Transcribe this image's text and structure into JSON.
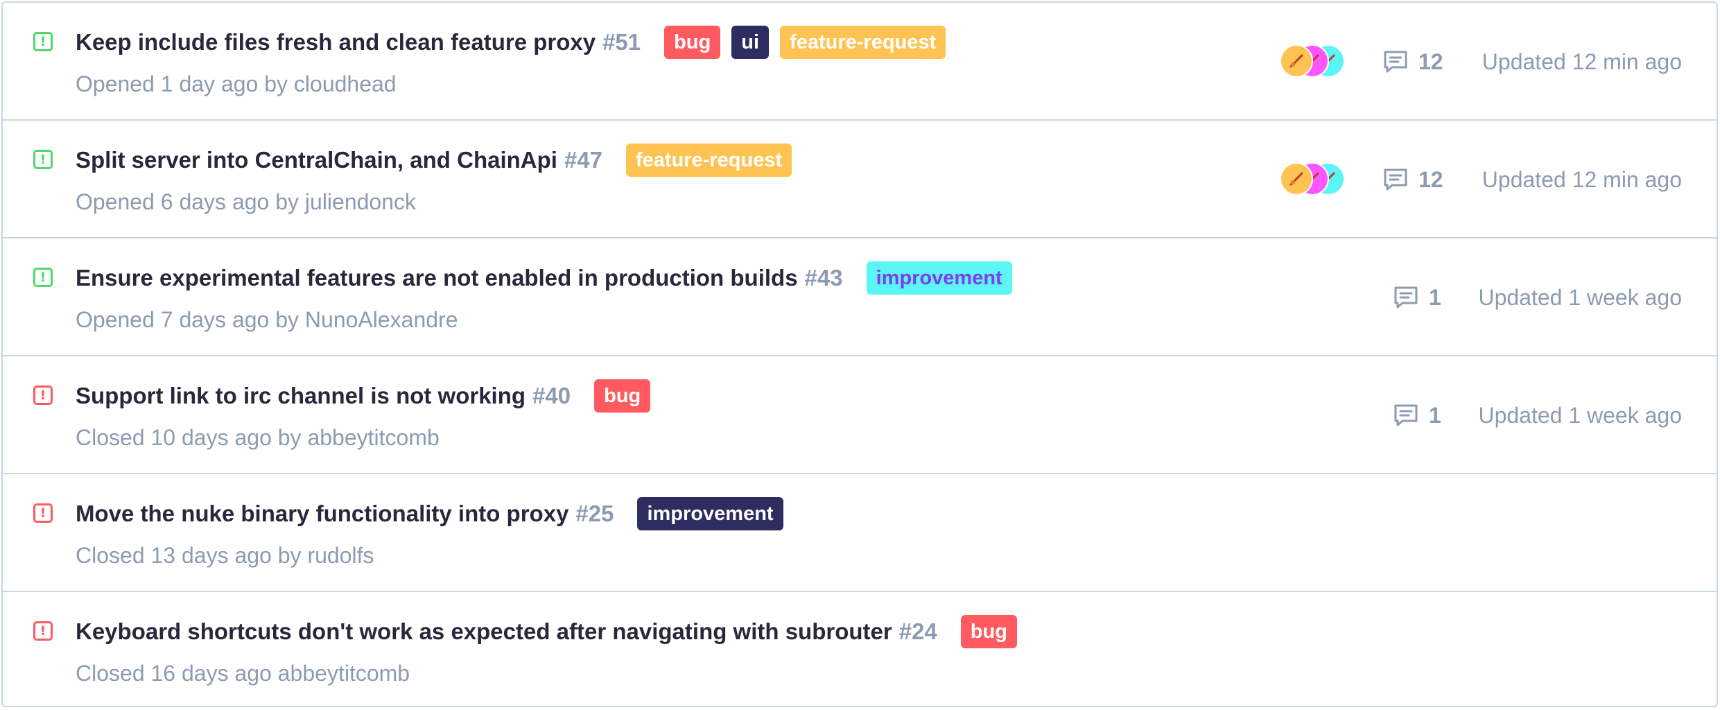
{
  "colors": {
    "open": "#4cd964",
    "closed": "#ff5a5f",
    "border": "#c9d6e3",
    "muted": "#8c9bb1",
    "text": "#28283c",
    "label_bug": "#ff5a5f",
    "label_ui": "#2d2d5f",
    "label_feature_request": "#ffc353",
    "label_improvement_cyan": "#5cf5f5",
    "label_improvement_navy": "#2d2d5f"
  },
  "issues": [
    {
      "status": "open",
      "title": "Keep include files fresh and clean feature proxy",
      "number": "#51",
      "labels": [
        {
          "text": "bug",
          "bg": "#ff5a5f",
          "fg": "#ffffff"
        },
        {
          "text": "ui",
          "bg": "#2d2d5f",
          "fg": "#ffffff"
        },
        {
          "text": "feature-request",
          "bg": "#ffc353",
          "fg": "#ffffff"
        }
      ],
      "meta": "Opened 1 day ago by cloudhead",
      "avatars": [
        "#ffc353",
        "#ff55ff",
        "#5cf5f5"
      ],
      "comments": "12",
      "updated": "Updated 12 min ago"
    },
    {
      "status": "open",
      "title": "Split server into CentralChain, and ChainApi",
      "number": "#47",
      "labels": [
        {
          "text": "feature-request",
          "bg": "#ffc353",
          "fg": "#ffffff"
        }
      ],
      "meta": "Opened 6 days ago by juliendonck",
      "avatars": [
        "#ffc353",
        "#ff55ff",
        "#5cf5f5"
      ],
      "comments": "12",
      "updated": "Updated 12 min ago"
    },
    {
      "status": "open",
      "title": "Ensure experimental features are not enabled in production builds",
      "number": "#43",
      "labels": [
        {
          "text": "improvement",
          "bg": "#5cf5f5",
          "fg": "#7b3ff2"
        }
      ],
      "meta": "Opened 7 days ago by NunoAlexandre",
      "avatars": [],
      "comments": "1",
      "updated": "Updated 1 week ago"
    },
    {
      "status": "closed",
      "title": "Support link to irc channel is not working",
      "number": "#40",
      "labels": [
        {
          "text": "bug",
          "bg": "#ff5a5f",
          "fg": "#ffffff"
        }
      ],
      "meta": "Closed 10 days ago by abbeytitcomb",
      "avatars": [],
      "comments": "1",
      "updated": "Updated 1 week ago"
    },
    {
      "status": "closed",
      "title": "Move the nuke binary functionality into proxy",
      "number": "#25",
      "labels": [
        {
          "text": "improvement",
          "bg": "#2d2d5f",
          "fg": "#ffffff"
        }
      ],
      "meta": "Closed 13 days ago by rudolfs",
      "avatars": [],
      "comments": "",
      "updated": ""
    },
    {
      "status": "closed",
      "title": "Keyboard shortcuts don't work as expected after navigating with subrouter",
      "number": "#24",
      "labels": [
        {
          "text": "bug",
          "bg": "#ff5a5f",
          "fg": "#ffffff"
        }
      ],
      "meta": "Closed 16 days ago abbeytitcomb",
      "avatars": [],
      "comments": "",
      "updated": ""
    }
  ]
}
